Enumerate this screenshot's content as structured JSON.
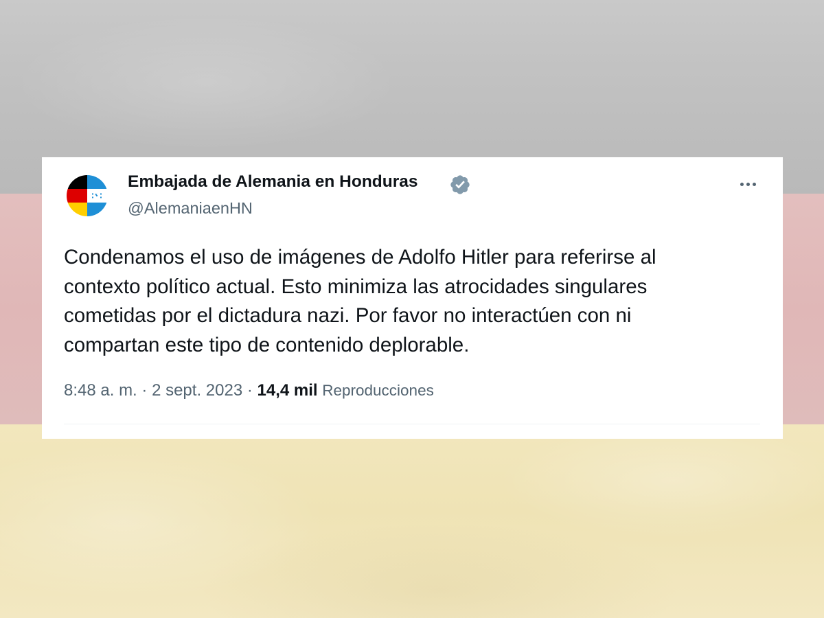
{
  "background": {
    "flag": "germany",
    "colors": {
      "top": "#c2c2c2",
      "middle": "#e0b8b8",
      "bottom": "#f0e4b8"
    }
  },
  "tweet": {
    "author": {
      "display_name": "Embajada de Alemania en Honduras",
      "handle": "@AlemaniaenHN",
      "verified": true,
      "verified_icon": "verified-badge-icon",
      "verified_color": "#829aab",
      "avatar_icon": "germany-honduras-flags-avatar"
    },
    "more_icon": "more-horizontal-icon",
    "text_lines": [
      "Condenamos el uso de imágenes de Adolfo Hitler para referirse al",
      "contexto político actual. Esto minimiza las atrocidades singulares",
      "cometidas por el dictadura nazi. Por favor no interactúen con ni",
      "compartan este tipo de contenido deplorable."
    ],
    "meta": {
      "time": "8:48 a. m.",
      "separator": " · ",
      "date": "2 sept. 2023",
      "views_count": "14,4 mil",
      "views_label": "Reproducciones"
    },
    "colors": {
      "text_primary": "#0f1419",
      "text_secondary": "#536471"
    }
  }
}
